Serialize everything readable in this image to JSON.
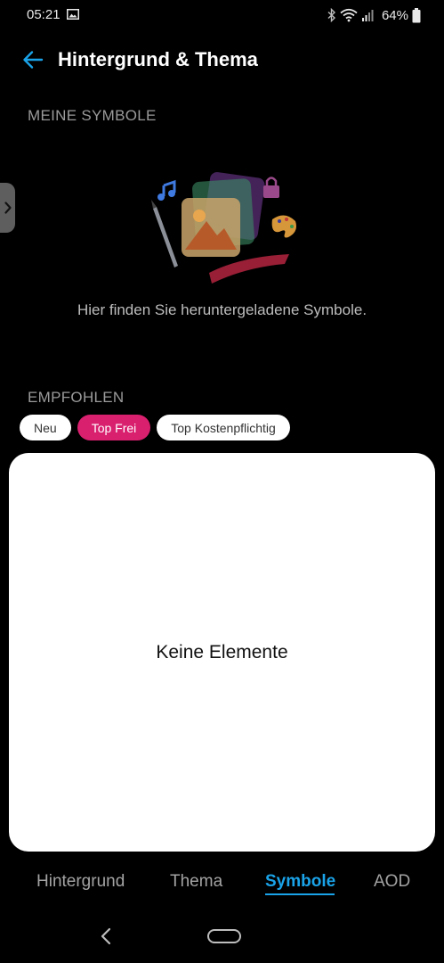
{
  "status_bar": {
    "time": "05:21",
    "battery": "64%"
  },
  "header": {
    "title": "Hintergrund & Thema"
  },
  "my_symbols": {
    "heading": "MEINE SYMBOLE",
    "empty_text": "Hier finden Sie heruntergeladene Symbole."
  },
  "recommended": {
    "heading": "EMPFOHLEN",
    "chips": [
      {
        "label": "Neu",
        "active": false
      },
      {
        "label": "Top Frei",
        "active": true
      },
      {
        "label": "Top Kostenpflichtig",
        "active": false
      }
    ]
  },
  "content": {
    "empty_label": "Keine Elemente"
  },
  "tabs": [
    {
      "label": "Hintergrund",
      "active": false
    },
    {
      "label": "Thema",
      "active": false
    },
    {
      "label": "Symbole",
      "active": true
    },
    {
      "label": "AOD",
      "active": false
    }
  ],
  "colors": {
    "accent_blue": "#1aa3e8",
    "chip_active": "#d9206f",
    "background": "#000000"
  },
  "icons": [
    "gallery-icon",
    "bluetooth-icon",
    "wifi-icon",
    "signal-icon",
    "battery-icon",
    "back-arrow-icon",
    "chevron-right-icon",
    "nav-back-icon",
    "nav-home-icon"
  ]
}
